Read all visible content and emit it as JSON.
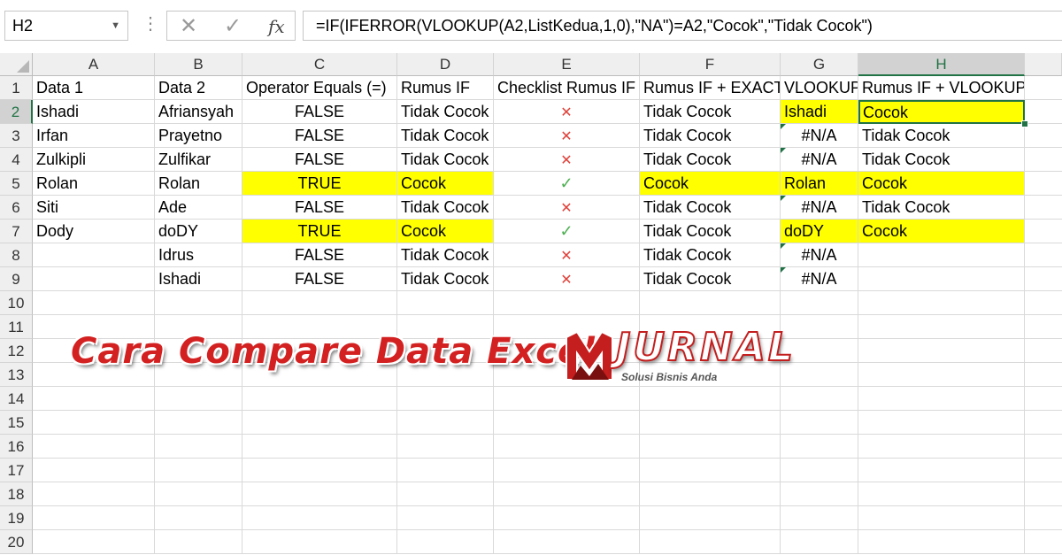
{
  "formula_bar": {
    "name_box": "H2",
    "cancel_symbol": "✕",
    "enter_symbol": "✓",
    "fx_label": "fx",
    "formula": "=IF(IFERROR(VLOOKUP(A2,ListKedua,1,0),\"NA\")=A2,\"Cocok\",\"Tidak Cocok\")"
  },
  "columns": [
    "A",
    "B",
    "C",
    "D",
    "E",
    "F",
    "G",
    "H"
  ],
  "rows": [
    "1",
    "2",
    "3",
    "4",
    "5",
    "6",
    "7",
    "8",
    "9",
    "10",
    "11",
    "12",
    "13",
    "14",
    "15",
    "16",
    "17",
    "18",
    "19",
    "20"
  ],
  "headers": [
    "Data 1",
    "Data 2",
    "Operator Equals (=)",
    "Rumus IF",
    "Checklist Rumus IF",
    "Rumus IF + EXACT",
    "VLOOKUP",
    "Rumus IF + VLOOKUP"
  ],
  "data_rows": [
    {
      "a": "Ishadi",
      "b": "Afriansyah",
      "c": "FALSE",
      "d": "Tidak Cocok",
      "e": "✕",
      "f": "Tidak Cocok",
      "g": "Ishadi",
      "h": "Cocok"
    },
    {
      "a": "Irfan",
      "b": "Prayetno",
      "c": "FALSE",
      "d": "Tidak Cocok",
      "e": "✕",
      "f": "Tidak Cocok",
      "g": "#N/A",
      "h": "Tidak Cocok"
    },
    {
      "a": "Zulkipli",
      "b": "Zulfikar",
      "c": "FALSE",
      "d": "Tidak Cocok",
      "e": "✕",
      "f": "Tidak Cocok",
      "g": "#N/A",
      "h": "Tidak Cocok"
    },
    {
      "a": "Rolan",
      "b": "Rolan",
      "c": "TRUE",
      "d": "Cocok",
      "e": "✓",
      "f": "Cocok",
      "g": "Rolan",
      "h": "Cocok"
    },
    {
      "a": "Siti",
      "b": "Ade",
      "c": "FALSE",
      "d": "Tidak Cocok",
      "e": "✕",
      "f": "Tidak Cocok",
      "g": "#N/A",
      "h": "Tidak Cocok"
    },
    {
      "a": "Dody",
      "b": "doDY",
      "c": "TRUE",
      "d": "Cocok",
      "e": "✓",
      "f": "Tidak Cocok",
      "g": "doDY",
      "h": "Cocok"
    },
    {
      "a": "",
      "b": "Idrus",
      "c": "FALSE",
      "d": "Tidak Cocok",
      "e": "✕",
      "f": "Tidak Cocok",
      "g": "#N/A",
      "h": ""
    },
    {
      "a": "",
      "b": "Ishadi",
      "c": "FALSE",
      "d": "Tidak Cocok",
      "e": "✕",
      "f": "Tidak Cocok",
      "g": "#N/A",
      "h": ""
    }
  ],
  "overlay": {
    "title": "Cara Compare Data Excel",
    "logo_word": "JURNAL",
    "logo_tagline": "Solusi Bisnis Anda"
  },
  "colors": {
    "highlight": "#ffff00",
    "selection": "#217346",
    "cross": "#e0413a",
    "check": "#4caf50",
    "title": "#d32020"
  }
}
